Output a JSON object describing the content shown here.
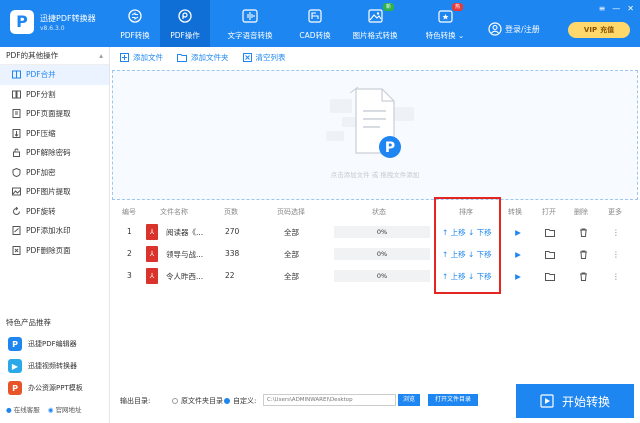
{
  "app": {
    "name": "迅捷PDF转换器",
    "version": "v8.6.3.0",
    "logo": "P"
  },
  "nav": [
    {
      "label": "PDF转换",
      "icon": "convert-icon",
      "active": false
    },
    {
      "label": "PDF操作",
      "icon": "pdf-operate-icon",
      "active": true
    },
    {
      "label": "文字语音转换",
      "icon": "audio-wave-icon",
      "active": false
    },
    {
      "label": "CAD转换",
      "icon": "cad-icon",
      "active": false,
      "badge": ""
    },
    {
      "label": "图片格式转换",
      "icon": "image-icon",
      "active": false,
      "badge": "新"
    },
    {
      "label": "特色转换",
      "icon": "special-icon",
      "active": false,
      "badge": "热"
    }
  ],
  "header": {
    "login": "登录/注册",
    "vip": "VIP",
    "recharge": "充值"
  },
  "sidebar": {
    "title": "PDF的其他操作",
    "items": [
      {
        "label": "PDF合并",
        "active": true
      },
      {
        "label": "PDF分割",
        "active": false
      },
      {
        "label": "PDF页面提取",
        "active": false
      },
      {
        "label": "PDF压缩",
        "active": false
      },
      {
        "label": "PDF解除密码",
        "active": false
      },
      {
        "label": "PDF加密",
        "active": false
      },
      {
        "label": "PDF图片提取",
        "active": false
      },
      {
        "label": "PDF旋转",
        "active": false
      },
      {
        "label": "PDF添加水印",
        "active": false
      },
      {
        "label": "PDF删除页面",
        "active": false
      }
    ],
    "rec_title": "特色产品推荐",
    "recs": [
      {
        "label": "迅捷PDF编辑器",
        "color": "#1e86f0"
      },
      {
        "label": "迅捷视频转换器",
        "color": "#2aa8e8"
      },
      {
        "label": "办公资源PPT模板",
        "color": "#e8542a"
      }
    ],
    "footer": {
      "support": "在线客服",
      "website": "官网地址"
    }
  },
  "toolbar": {
    "add_file": "添加文件",
    "add_folder": "添加文件夹",
    "clear_list": "清空列表"
  },
  "dropzone": {
    "hint": "点击添加文件 或 拖拽文件添加"
  },
  "table": {
    "headers": [
      "编号",
      "文件名称",
      "页数",
      "页码选择",
      "状态",
      "排序",
      "转换",
      "打开",
      "删除",
      "更多"
    ],
    "rows": [
      {
        "index": "1",
        "name": "阅读器《...",
        "pages": "270",
        "range": "全部",
        "status": "0%"
      },
      {
        "index": "2",
        "name": "领导与战...",
        "pages": "338",
        "range": "全部",
        "status": "0%"
      },
      {
        "index": "3",
        "name": "令人昨西...",
        "pages": "22",
        "range": "全部",
        "status": "0%"
      }
    ],
    "move_up": "上移",
    "move_down": "下移"
  },
  "bottom": {
    "output_label": "输出目录:",
    "option_source": "原文件夹目录",
    "option_custom": "自定义:",
    "path": "C:\\Users\\ADMINWAREI\\Desktop",
    "browse": "浏览",
    "open_folder": "打开文件目录",
    "start": "开始转换"
  },
  "colors": {
    "primary": "#1e86f0",
    "highlight": "#e52521",
    "pdf": "#d9332c"
  }
}
